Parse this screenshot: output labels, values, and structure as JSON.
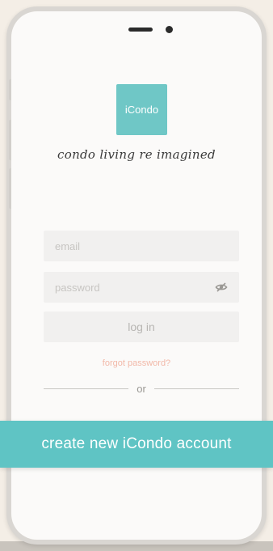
{
  "logo": {
    "text": "iCondo",
    "color": "#6fc7c6"
  },
  "tagline": "condo living re imagined",
  "login_form": {
    "email_placeholder": "email",
    "password_placeholder": "password",
    "password_toggle_icon": "eye-slash-icon",
    "login_label": "log in",
    "forgot_label": "forgot password?",
    "divider_label": "or"
  },
  "create_account": {
    "label": "create new iCondo account",
    "color": "#5fc4c4"
  },
  "colors": {
    "background": "#f4eee6",
    "accent": "#5fc4c4",
    "forgot_link": "#f2b9a9"
  }
}
